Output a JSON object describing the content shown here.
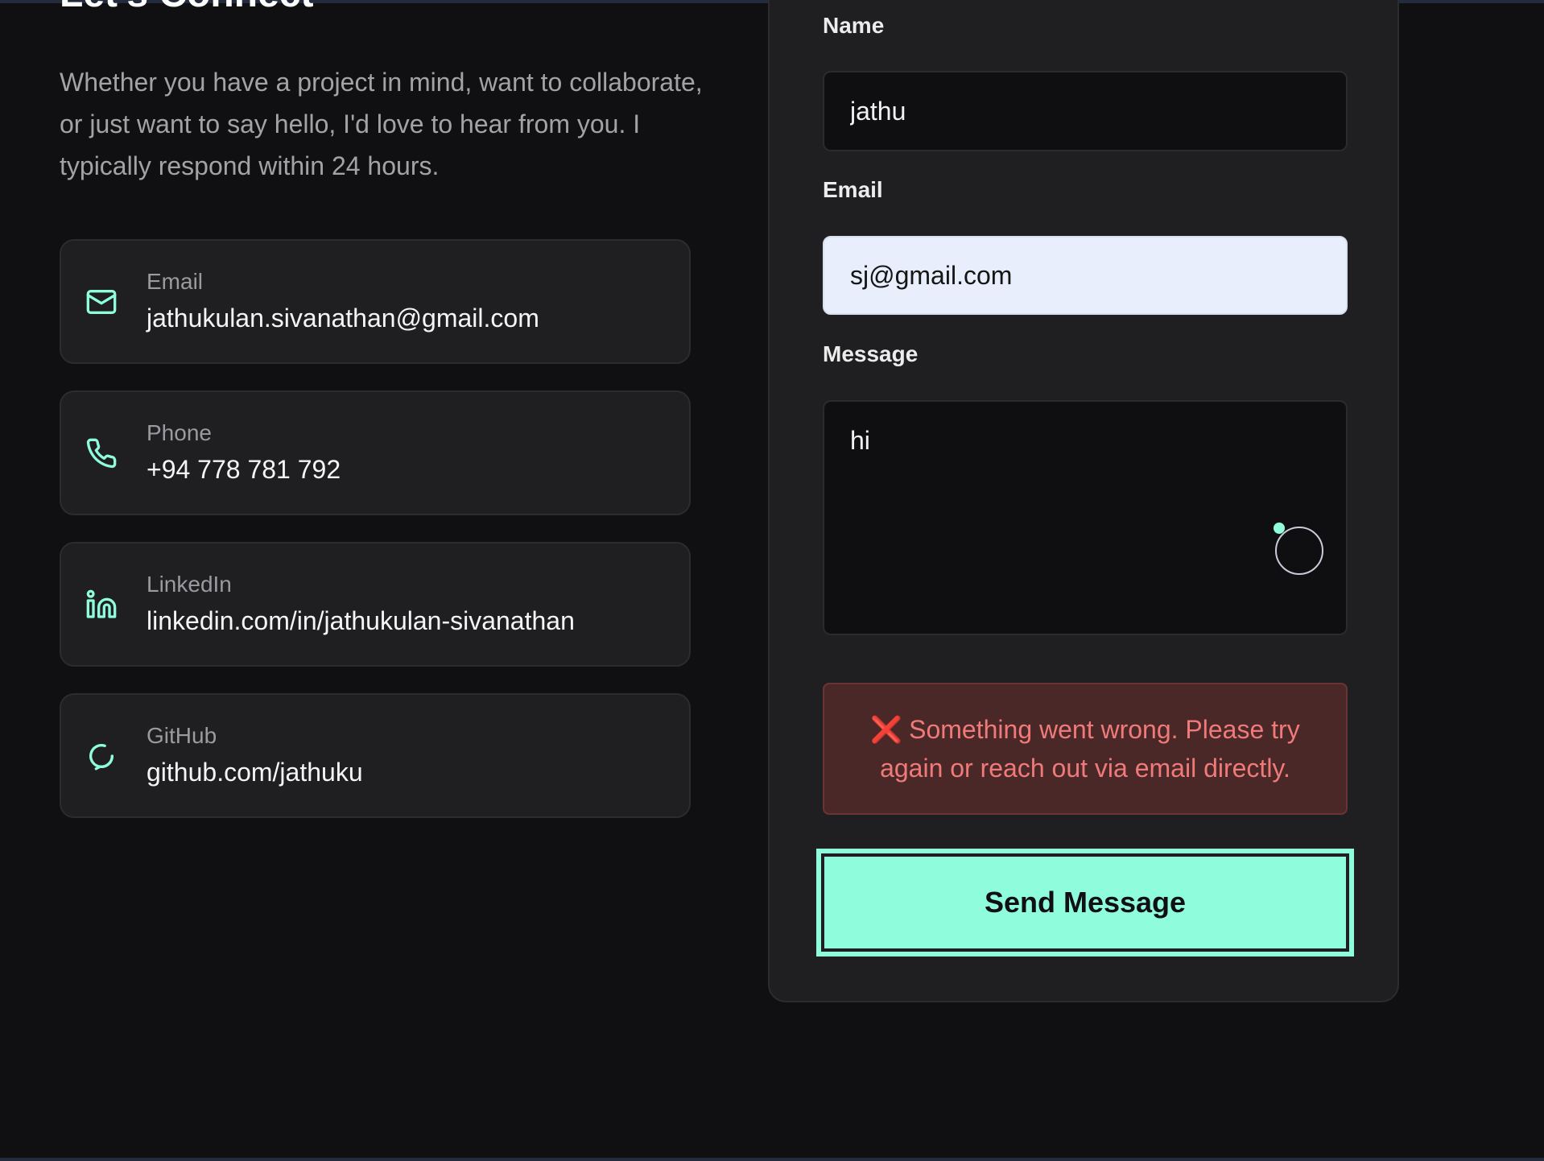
{
  "heading": "Let's Connect",
  "intro": "Whether you have a project in mind, want to collaborate, or just want to say hello, I'd love to hear from you. I typically respond within 24 hours.",
  "contacts": [
    {
      "label": "Email",
      "value": "jathukulan.sivanathan@gmail.com",
      "icon": "mail-icon"
    },
    {
      "label": "Phone",
      "value": "+94 778 781 792",
      "icon": "phone-icon"
    },
    {
      "label": "LinkedIn",
      "value": "linkedin.com/in/jathukulan-sivanathan",
      "icon": "linkedin-icon"
    },
    {
      "label": "GitHub",
      "value": "github.com/jathuku",
      "icon": "github-icon"
    }
  ],
  "form": {
    "name_label": "Name",
    "name_value": "jathu",
    "email_label": "Email",
    "email_value": "sj@gmail.com",
    "message_label": "Message",
    "message_value": "hi",
    "error_icon": "❌",
    "error_text": "Something went wrong. Please try again or reach out via email directly.",
    "submit_label": "Send Message"
  },
  "colors": {
    "accent": "#8ffcdb",
    "background": "#101012",
    "card": "#1f1f21",
    "error_bg": "#4a2828",
    "error_text": "#f07a7a"
  }
}
